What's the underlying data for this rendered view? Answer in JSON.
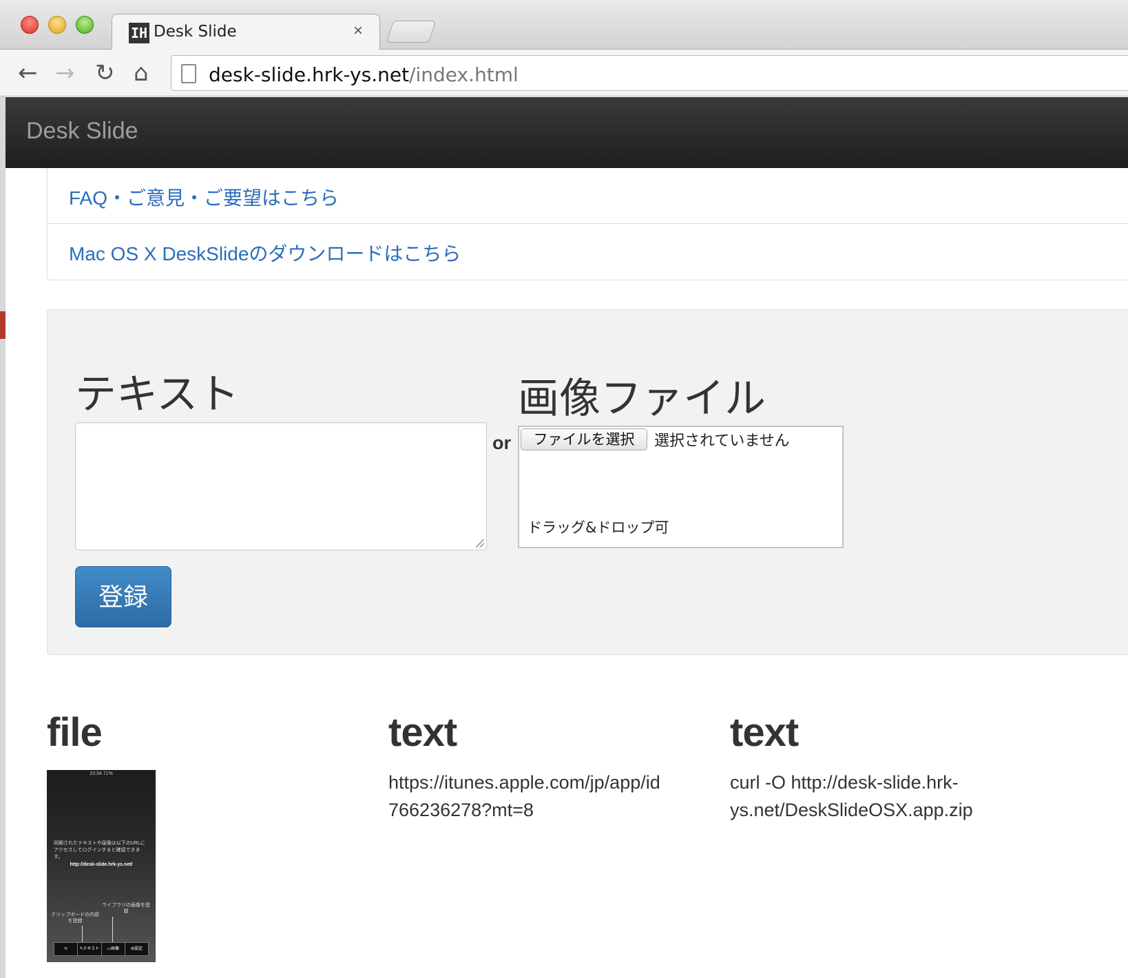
{
  "browser": {
    "tab_title": "Desk Slide",
    "tab_close": "×",
    "favicon": "IH",
    "url_host": "desk-slide.hrk-ys.net",
    "url_path": "/index.html",
    "icons": {
      "back": "←",
      "forward": "→",
      "reload": "↻",
      "home": "⌂"
    }
  },
  "navbar": {
    "brand": "Desk Slide"
  },
  "links": [
    {
      "label": "FAQ・ご意見・ご要望はこちら"
    },
    {
      "label": "Mac OS X DeskSlideのダウンロードはこちら"
    }
  ],
  "form": {
    "text_heading": "テキスト",
    "image_heading": "画像ファイル",
    "or_label": "or",
    "file_button": "ファイルを選択",
    "file_status": "選択されていません",
    "drop_hint": "ドラッグ&ドロップ可",
    "submit": "登録"
  },
  "items": [
    {
      "type": "file",
      "thumbnail": {
        "time": "23:34",
        "battery": "71%",
        "message": "同期されたテキストや画像は以下のURLにアクセスしてログインすると確認できます。",
        "url": "http://desk-slide.hrk-ys.net/",
        "label_clipboard": "クリップボードの内容を登録",
        "label_library": "ライブラリの画像を登録",
        "tabs": [
          "↻",
          "✎テキスト",
          "▭画像",
          "⚙設定"
        ]
      }
    },
    {
      "type": "text",
      "body_lines": [
        "https://itunes.apple.com/jp/app/id",
        "766236278?mt=8"
      ]
    },
    {
      "type": "text",
      "body_lines": [
        "curl -O http://desk-slide.hrk-",
        "ys.net/DeskSlideOSX.app.zip"
      ]
    }
  ]
}
